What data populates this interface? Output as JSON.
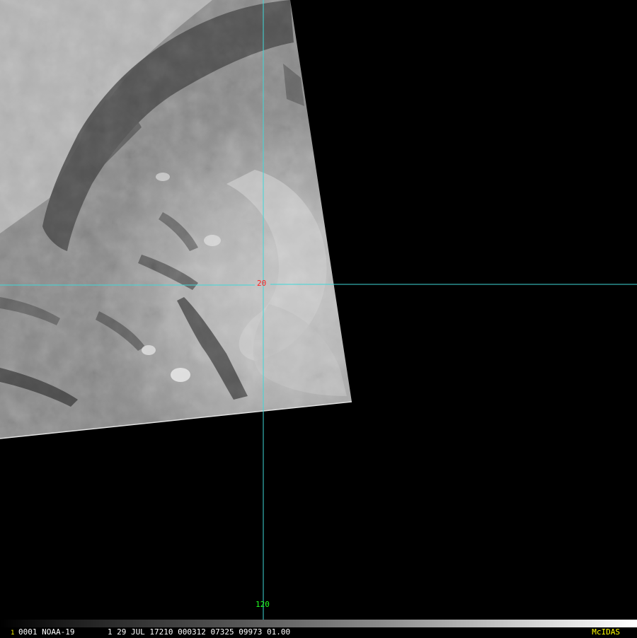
{
  "display": {
    "frame_number": "1",
    "info_line": "0001 NOAA-19       1 29 JUL 17210 000312 07325 09973 01.00",
    "brand": "McIDAS"
  },
  "grid": {
    "latitude_label": "20",
    "longitude_label": "120"
  },
  "colors": {
    "background": "#000000",
    "grid_line": "#3fd8d8",
    "latitude_label": "#ff2020",
    "longitude_label": "#20ff20",
    "frame_number": "#ffff00",
    "info_text": "#ffffff",
    "brand_text": "#ffff00",
    "cloud_bright": "#d0d0d0",
    "cloud_mid": "#9a9a9a",
    "cloud_dark": "#4a4a4a"
  },
  "icons": {
    "satellite_swath": "satellite-image-swath"
  }
}
